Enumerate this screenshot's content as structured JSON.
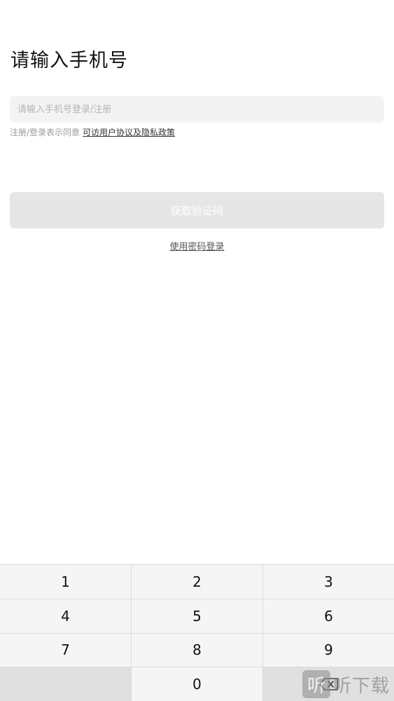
{
  "page": {
    "title": "请输入手机号"
  },
  "phone": {
    "placeholder": "请输入手机号登录/注册"
  },
  "agreement": {
    "prefix": "注册/登录表示同意",
    "link": "可访用户协议及隐私政策"
  },
  "actions": {
    "get_code": "获取验证码",
    "password_login": "使用密码登录"
  },
  "keypad": {
    "keys": [
      "1",
      "2",
      "3",
      "4",
      "5",
      "6",
      "7",
      "8",
      "9",
      "",
      "0",
      "delete"
    ]
  },
  "watermark": {
    "logo_glyph": "听",
    "text": "听下载"
  },
  "colors": {
    "input_bg": "#f3f3f3",
    "button_disabled_bg": "#e6e6e6",
    "keypad_bg": "#f5f5f5"
  }
}
